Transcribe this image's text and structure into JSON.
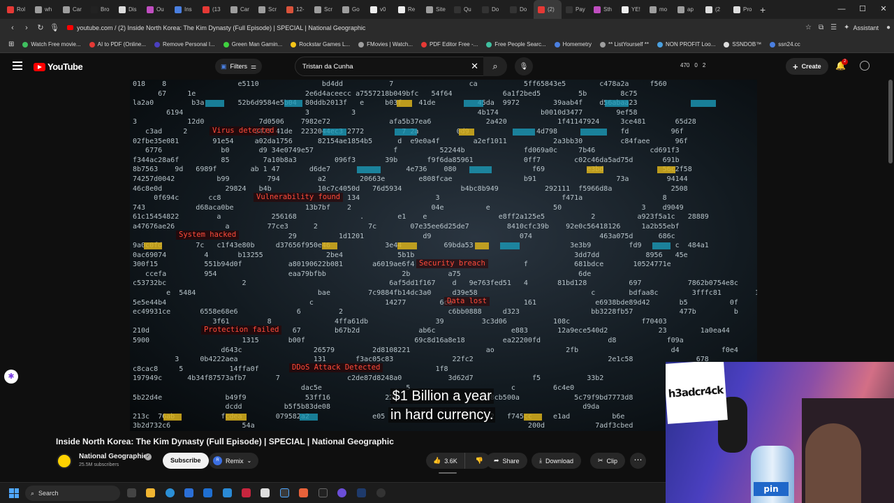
{
  "browser": {
    "tabs": [
      {
        "label": "Rol",
        "color": "#e53935"
      },
      {
        "label": "wh",
        "color": "#9e9e9e"
      },
      {
        "label": "Car",
        "color": "#9e9e9e"
      },
      {
        "label": "Bro",
        "color": "#222222"
      },
      {
        "label": "Dis",
        "color": "#dddddd"
      },
      {
        "label": "Ou",
        "color": "#c04ec0"
      },
      {
        "label": "Ins",
        "color": "#4a7fe0"
      },
      {
        "label": "(13",
        "color": "#e53935"
      },
      {
        "label": "Car",
        "color": "#9e9e9e"
      },
      {
        "label": "Scr",
        "color": "#9e9e9e"
      },
      {
        "label": "12-",
        "color": "#d9533b"
      },
      {
        "label": "Scr",
        "color": "#9e9e9e"
      },
      {
        "label": "Go",
        "color": "#9e9e9e"
      },
      {
        "label": "v0",
        "color": "#eeeeee"
      },
      {
        "label": "Re",
        "color": "#eeeeee"
      },
      {
        "label": "Site",
        "color": "#9e9e9e"
      },
      {
        "label": "Qu",
        "color": "#333333"
      },
      {
        "label": "Do",
        "color": "#333333"
      },
      {
        "label": "Do",
        "color": "#333333"
      },
      {
        "label": "(2)",
        "color": "#e53935",
        "active": true
      },
      {
        "label": "Pay",
        "color": "#333333"
      },
      {
        "label": "Sth",
        "color": "#c04ec0"
      },
      {
        "label": "YE!",
        "color": "#eeeeee"
      },
      {
        "label": "mo",
        "color": "#9e9e9e"
      },
      {
        "label": "ap",
        "color": "#9e9e9e"
      },
      {
        "label": "(2",
        "color": "#dddddd"
      },
      {
        "label": "Pro",
        "color": "#dddddd"
      }
    ],
    "new_tab": "+",
    "url": "youtube.com / (2) Inside North Korea: The Kim Dynasty (Full Episode) | SPECIAL | National Geographic",
    "assistant_label": "Assistant",
    "bookmarks": [
      {
        "label": "Watch Free movie...",
        "color": "#3fbf5f"
      },
      {
        "label": "AI to PDF (Online...",
        "color": "#e53935"
      },
      {
        "label": "Remove Personal I...",
        "color": "#4a3fbf"
      },
      {
        "label": "Green Man Gamin...",
        "color": "#3fd13f"
      },
      {
        "label": "Rockstar Games L...",
        "color": "#f5c518"
      },
      {
        "label": "FMovies | Watch...",
        "color": "#9e9e9e"
      },
      {
        "label": "PDF Editor Free -...",
        "color": "#e53935"
      },
      {
        "label": "Free People Searc...",
        "color": "#3fbf9f"
      },
      {
        "label": "Homemetry",
        "color": "#4a7fe0"
      },
      {
        "label": "** ListYourself **",
        "color": "#9e9e9e"
      },
      {
        "label": "NON PROFIT Loo...",
        "color": "#4aa0e0"
      },
      {
        "label": "SSNDOB™",
        "color": "#dddddd"
      },
      {
        "label": "ssn24.cc",
        "color": "#4a7fe0"
      }
    ]
  },
  "youtube": {
    "logo_text": "YouTube",
    "filters_label": "Filters",
    "search_value": "Tristan da Cunha",
    "ext_counters": [
      "470",
      "0",
      "2"
    ],
    "create_label": "Create",
    "notification_count": "2"
  },
  "video": {
    "alerts": [
      "Virus detected",
      "Vulnerability found",
      "System hacked",
      "Security breach",
      "Data lost",
      "Protection failed",
      "DDoS Attack Detected"
    ],
    "caption_line1": "$1 Billion a year",
    "caption_line2": "in hard currency.",
    "title": "Inside North Korea: The Kim Dynasty (Full Episode) | SPECIAL | National Geographic",
    "channel_name": "National Geographic",
    "subscribers": "25.5M subscribers",
    "subscribe_label": "Subscribe",
    "remix_label": "Remix",
    "like_count": "3.6K",
    "share_label": "Share",
    "download_label": "Download",
    "clip_label": "Clip",
    "more_label": "⋯"
  },
  "webcam": {
    "logo_text": "h3adcr4ck",
    "bottle_label": "pin"
  },
  "taskbar": {
    "search_placeholder": "Search"
  },
  "colors": {
    "alert_red": "#ff4a3a",
    "yt_red": "#ff0000",
    "bg": "#0f0f0f"
  }
}
